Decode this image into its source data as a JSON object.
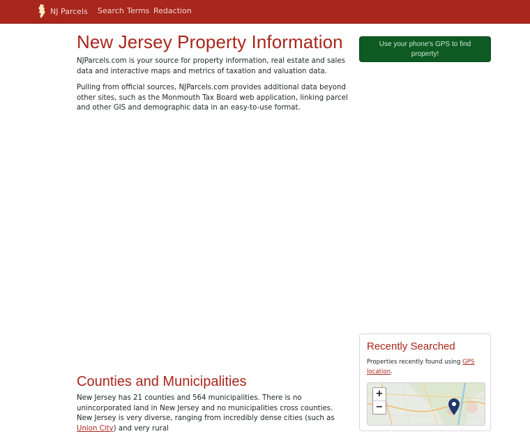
{
  "navbar": {
    "brand": "NJ Parcels",
    "links": [
      "Search",
      "Terms",
      "Redaction"
    ]
  },
  "main": {
    "title": "New Jersey Property Information",
    "intro": "NJParcels.com is your source for property information, real estate and sales data and interactive maps and metrics of taxation and valuation data.",
    "intro2": "Pulling from official sources, NJParcels.com provides additional data beyond other sites, such as the Monmouth Tax Board web application, linking parcel and other GIS and demographic data in an easy-to-use format.",
    "counties_title": "Counties and Municipalities",
    "counties_text_1": "New Jersey has 21 counties and 564 municipalities. There is no unincorporated land in New Jersey and no municipalities cross counties. New Jersey is very diverse, ranging from incredibly dense cities (such as ",
    "counties_link": "Union City",
    "counties_text_2": ") and very rural"
  },
  "sidebar": {
    "gps_button": "Use your phone's GPS to find property!",
    "recent_title": "Recently Searched",
    "recent_text": "Properties recently found using ",
    "recent_link": "GPS location",
    "recent_suffix": ".",
    "zoom_in": "+",
    "zoom_out": "−"
  },
  "colors": {
    "brand": "#a8261b",
    "nav_bg": "#a8261b",
    "gps_button_bg": "#0d5a23"
  }
}
